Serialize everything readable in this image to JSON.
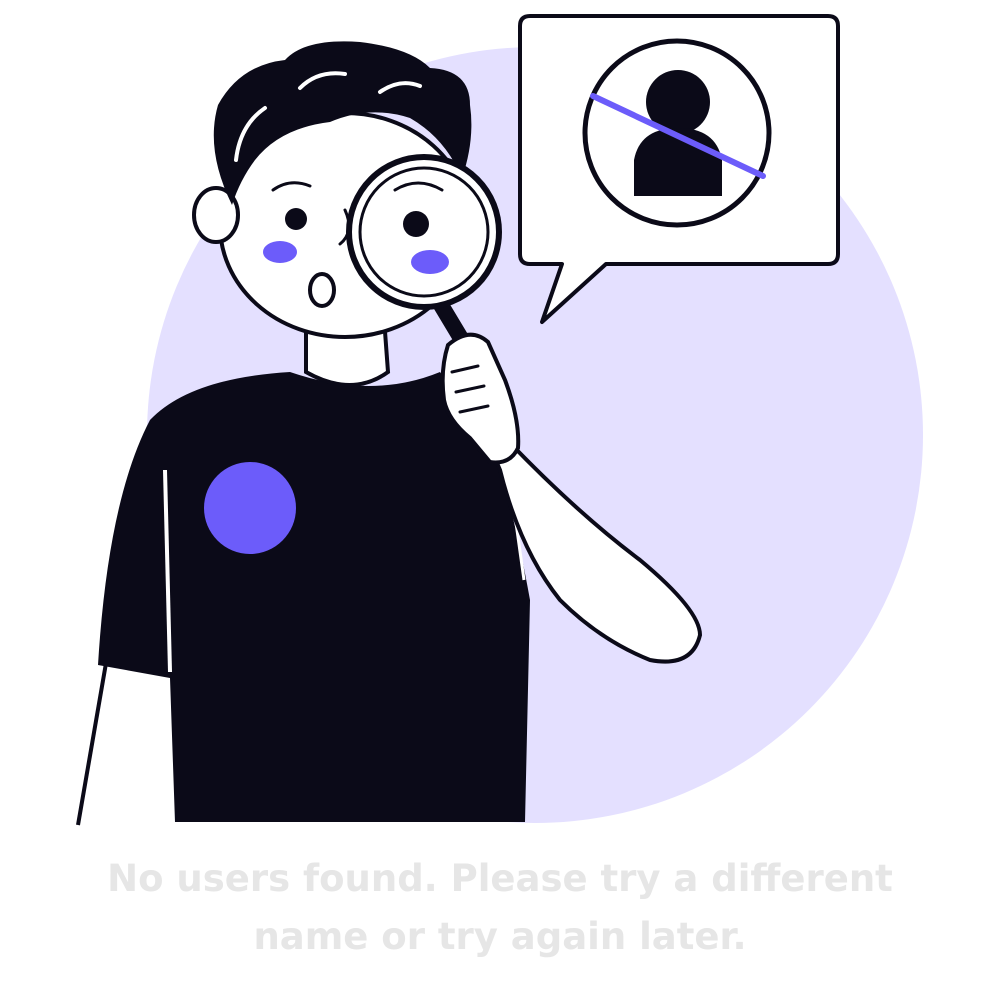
{
  "empty_state": {
    "message": "No users found. Please try a different name or try again later."
  },
  "colors": {
    "ink": "#0b0a18",
    "accent": "#6c5cfa",
    "backdrop": "#e4e0ff",
    "message": "#e6e6e6"
  },
  "icons": {
    "illustration": "person-with-magnifier",
    "bubble_icon": "no-user-icon"
  }
}
